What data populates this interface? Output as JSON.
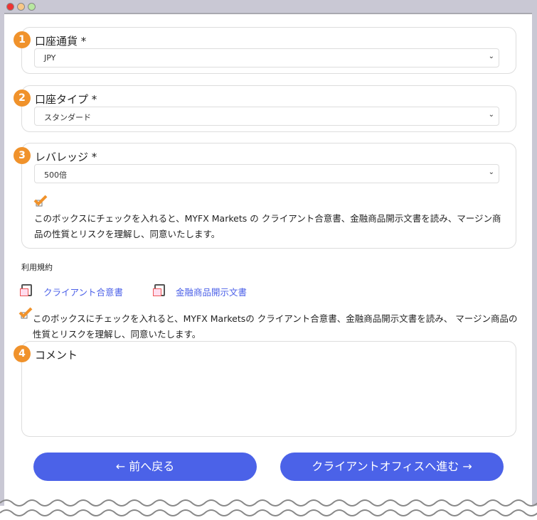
{
  "window": {
    "buttons": [
      "close",
      "minimize",
      "maximize"
    ]
  },
  "fields": [
    {
      "number": "1",
      "label": "口座通貨 *",
      "value": "JPY"
    },
    {
      "number": "2",
      "label": "口座タイプ *",
      "value": "スタンダード"
    },
    {
      "number": "3",
      "label": "レバレッジ *",
      "value": "500倍"
    }
  ],
  "leverage_agreement": {
    "checked": true,
    "text": "このボックスにチェックを入れると、MYFX Markets の クライアント合意書、金融商品開示文書を読み、マージン商品の性質とリスクを理解し、同意いたします。"
  },
  "terms": {
    "heading": "利用規約",
    "links": [
      "クライアント合意書",
      "金融商品開示文書"
    ]
  },
  "agreement": {
    "checked": true,
    "text": "このボックスにチェックを入れると、MYFX Marketsの クライアント合意書、金融商品開示文書を読み、 マージン商品の性質とリスクを理解し、同意いたします。"
  },
  "comment": {
    "number": "4",
    "label": "コメント",
    "value": ""
  },
  "buttons": {
    "back": "← 前へ戻る",
    "next": "クライアントオフィスへ進む →"
  },
  "colors": {
    "accent": "#f0922b",
    "primary": "#4b62e8",
    "link": "#4a5fe8"
  }
}
